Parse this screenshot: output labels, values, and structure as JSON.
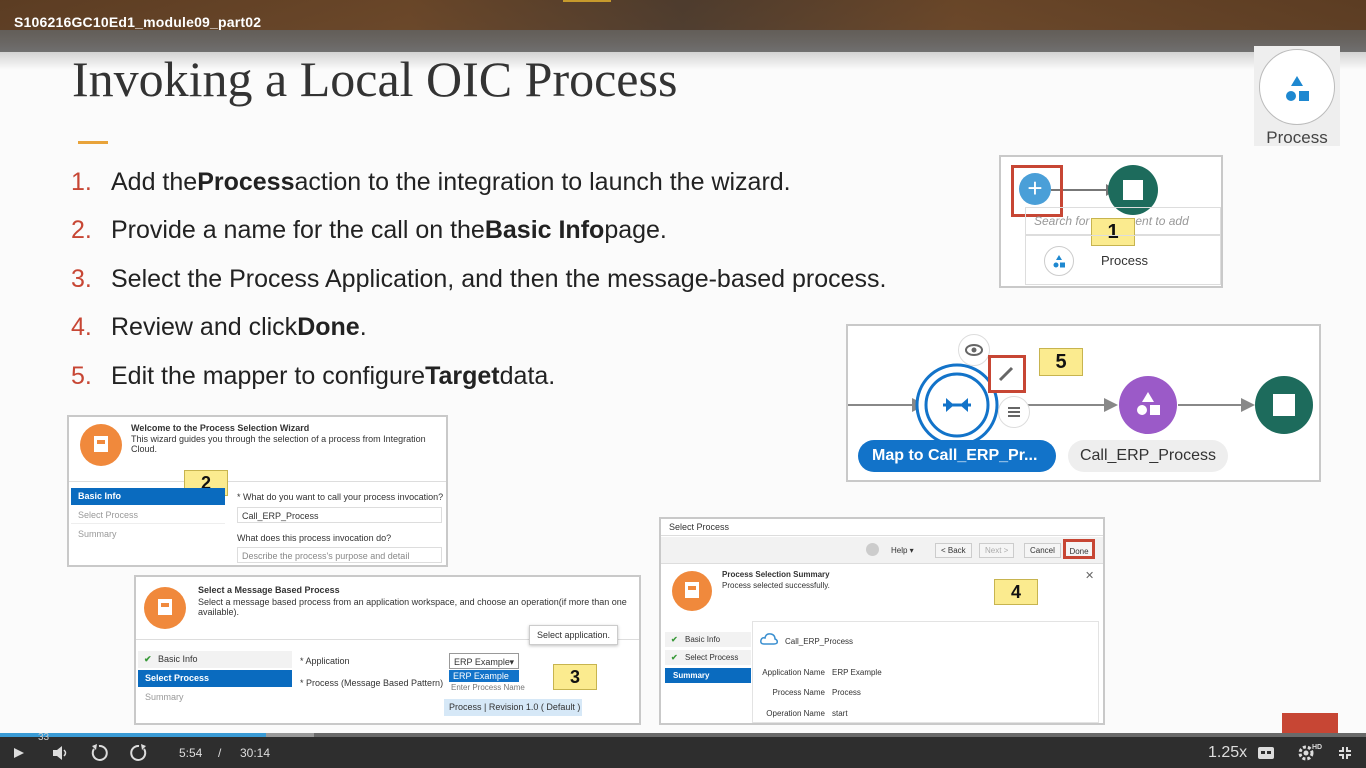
{
  "video": {
    "title": "S106216GC10Ed1_module09_part02",
    "current_time": "5:54",
    "separator": "/",
    "duration": "30:14",
    "progress_fraction": 0.195,
    "buffered_fraction": 0.23,
    "playback_speed": "1.25x",
    "overlay_number": "33",
    "hd_badge": "HD",
    "accent_color": "#3a9bd5"
  },
  "slide": {
    "title": "Invoking a Local OIC Process",
    "steps": [
      {
        "num": "1.",
        "pre": "Add the ",
        "bold": "Process",
        "post": " action to the integration to launch the wizard."
      },
      {
        "num": "2.",
        "pre": "Provide a name for the call on the ",
        "bold": "Basic Info",
        "post": " page."
      },
      {
        "num": "3.",
        "pre": "Select the Process Application, and then the message-based process.",
        "bold": "",
        "post": ""
      },
      {
        "num": "4.",
        "pre": "Review and click ",
        "bold": "Done",
        "post": "."
      },
      {
        "num": "5.",
        "pre": "Edit the mapper to configure ",
        "bold": "Target",
        "post": " data."
      }
    ],
    "badge_label": "Process"
  },
  "shot1": {
    "search_placeholder": "Search for component to add",
    "callout": "1",
    "item_label": "Process"
  },
  "shot5": {
    "callout": "5",
    "map_label": "Map to Call_ERP_Pr...",
    "call_label": "Call_ERP_Process"
  },
  "shot2": {
    "title": "Welcome to the Process Selection Wizard",
    "subtitle": "This wizard guides you through the selection of a process from Integration Cloud.",
    "callout": "2",
    "nav": [
      "Basic Info",
      "Select Process",
      "Summary"
    ],
    "q1": "* What do you want to call your process invocation?",
    "q1_value": "Call_ERP_Process",
    "q2": "What does this process invocation do?",
    "q2_placeholder": "Describe the process's purpose and detail"
  },
  "shot3": {
    "title": "Select a Message Based Process",
    "subtitle": "Select a message based process from an application workspace, and choose an operation(if more than one available).",
    "tooltip": "Select application.",
    "callout": "3",
    "nav": [
      "Basic Info",
      "Select Process",
      "Summary"
    ],
    "application_label": "* Application",
    "application_value": "ERP Example",
    "dropdown_option": "ERP Example",
    "process_label": "* Process (Message Based Pattern)",
    "process_placeholder": "Enter Process Name",
    "process_option": "Process | Revision 1.0 ( Default )"
  },
  "shot4": {
    "header": "Select Process",
    "help": "Help",
    "back": "< Back",
    "next": "Next >",
    "cancel": "Cancel",
    "done": "Done",
    "summary_title": "Process Selection Summary",
    "summary_sub": "Process selected successfully.",
    "callout": "4",
    "nav": [
      "Basic Info",
      "Select Process",
      "Summary"
    ],
    "process_name_title": "Call_ERP_Process",
    "rows": [
      {
        "label": "Application Name",
        "value": "ERP Example"
      },
      {
        "label": "Process Name",
        "value": "Process"
      },
      {
        "label": "Operation Name",
        "value": "start"
      }
    ]
  }
}
